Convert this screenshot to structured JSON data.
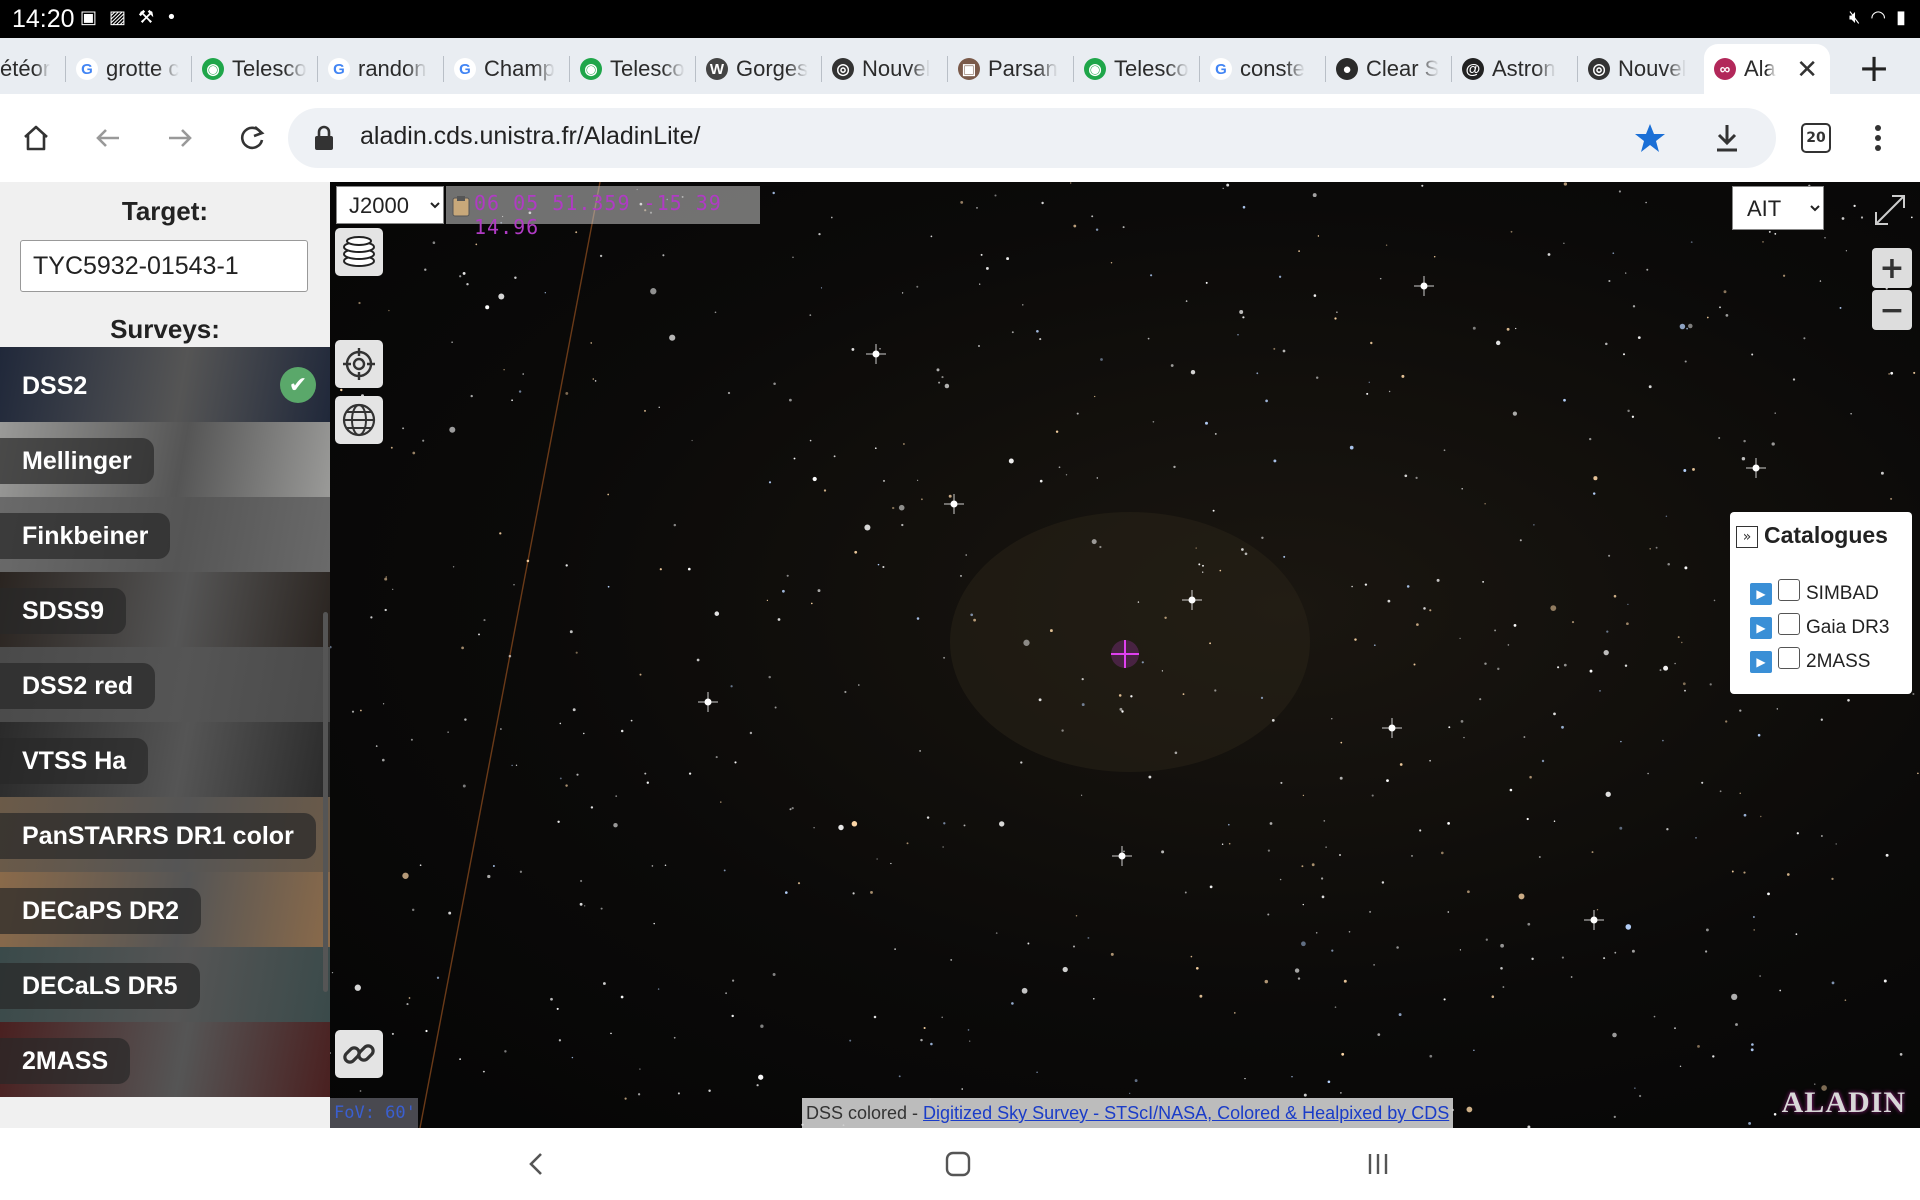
{
  "status": {
    "time": "14:20",
    "notif_icons": [
      "sim-icon",
      "image-icon",
      "sweep-icon",
      "dot-icon"
    ],
    "right_icons": [
      "mute-icon",
      "wifi-icon",
      "battery-icon"
    ]
  },
  "tabs": [
    {
      "label": "étéor",
      "favicon": "web-favicon",
      "color": "#4a76d0"
    },
    {
      "label": "grotte c",
      "favicon": "google-favicon",
      "color": "#4285f4"
    },
    {
      "label": "Telesco",
      "favicon": "telescope-favicon",
      "color": "#1fa64a"
    },
    {
      "label": "randon",
      "favicon": "google-favicon",
      "color": "#4285f4"
    },
    {
      "label": "Champ",
      "favicon": "google-favicon",
      "color": "#4285f4"
    },
    {
      "label": "Telesco",
      "favicon": "telescope-favicon",
      "color": "#1fa64a"
    },
    {
      "label": "Gorges",
      "favicon": "wikipedia-favicon",
      "color": "#444444"
    },
    {
      "label": "Nouvel",
      "favicon": "chrome-favicon",
      "color": "#333333"
    },
    {
      "label": "Parsan",
      "favicon": "image-favicon",
      "color": "#7a5a4a"
    },
    {
      "label": "Telesco",
      "favicon": "telescope-favicon",
      "color": "#1fa64a"
    },
    {
      "label": "conste",
      "favicon": "google-favicon",
      "color": "#4285f4"
    },
    {
      "label": "Clear S",
      "favicon": "planet-favicon",
      "color": "#2b2b2b"
    },
    {
      "label": "Astron",
      "favicon": "galaxy-favicon",
      "color": "#222222"
    },
    {
      "label": "Nouvel",
      "favicon": "chrome-favicon",
      "color": "#333333"
    },
    {
      "label": "Ala",
      "favicon": "aladin-favicon",
      "color": "#b2285a"
    }
  ],
  "toolbar": {
    "url": "aladin.cds.unistra.fr/AladinLite/",
    "tab_count": "20"
  },
  "left_panel": {
    "target_label": "Target:",
    "target_value": "TYC5932-01543-1",
    "surveys_label": "Surveys:",
    "surveys": [
      {
        "label": "DSS2",
        "selected": true,
        "bg": "#20283a"
      },
      {
        "label": "Mellinger",
        "selected": false,
        "bg": "#9a9a98"
      },
      {
        "label": "Finkbeiner",
        "selected": false,
        "bg": "#6a6a6a"
      },
      {
        "label": "SDSS9",
        "selected": false,
        "bg": "#2a2420"
      },
      {
        "label": "DSS2 red",
        "selected": false,
        "bg": "#4a4a4a"
      },
      {
        "label": "VTSS Ha",
        "selected": false,
        "bg": "#2a2a2a"
      },
      {
        "label": "PanSTARRS DR1 color",
        "selected": false,
        "bg": "#6b5a48"
      },
      {
        "label": "DECaPS DR2",
        "selected": false,
        "bg": "#8a6a4a"
      },
      {
        "label": "DECaLS DR5",
        "selected": false,
        "bg": "#3a4a4a"
      },
      {
        "label": "2MASS",
        "selected": false,
        "bg": "#4a2020"
      }
    ]
  },
  "sky": {
    "frame": "J2000",
    "frame_options": [
      "J2000"
    ],
    "coords": "06 05 51.359 -15 39 14.96",
    "projection": "AIT",
    "projection_options": [
      "AIT"
    ],
    "fov": "FoV: 60'",
    "attribution_prefix": "DSS colored - ",
    "attribution_link": "Digitized Sky Survey - STScI/NASA, Colored & Healpixed by CDS",
    "logo": "ALADIN",
    "catalogues": {
      "title": "Catalogues",
      "items": [
        "SIMBAD",
        "Gaia DR3",
        "2MASS"
      ]
    }
  }
}
